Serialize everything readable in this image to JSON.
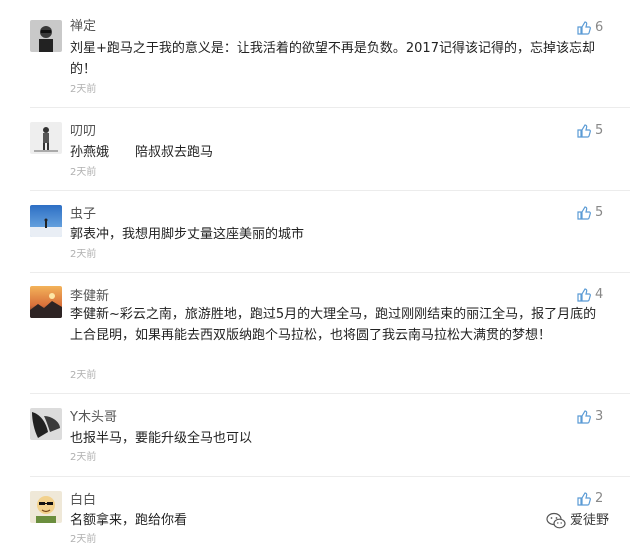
{
  "comments": [
    {
      "nickname": "禅定",
      "likes": "6",
      "content": "刘星+跑马之于我的意义是：让我活着的欲望不再是负数。2017记得该记得的，忘掉该忘却的！",
      "time": "2天前"
    },
    {
      "nickname": "叨叨",
      "likes": "5",
      "content": "孙燕娥　　陪叔叔去跑马",
      "time": "2天前"
    },
    {
      "nickname": "虫子",
      "likes": "5",
      "content": "郭表冲，我想用脚步丈量这座美丽的城市",
      "time": "2天前"
    },
    {
      "nickname": "李健新",
      "likes": "4",
      "content": "李健新~彩云之南，旅游胜地，跑过5月的大理全马，跑过刚刚结束的丽江全马，报了月底的上合昆明，如果再能去西双版纳跑个马拉松，也将圆了我云南马拉松大满贯的梦想！",
      "time": "2天前"
    },
    {
      "nickname": "Y木头哥",
      "likes": "3",
      "content": "也报半马，要能升级全马也可以",
      "time": "2天前"
    },
    {
      "nickname": "白白",
      "likes": "2",
      "content": "名额拿来，跑给你看",
      "time": "2天前"
    }
  ],
  "watermark": {
    "text": "爱徒野",
    "icon": "wechat-icon"
  },
  "icons": {
    "like": "thumbs-up-icon"
  },
  "colors": {
    "like_icon": "#5b9bd5",
    "time": "#b0b0b0",
    "nickname": "#555555"
  }
}
